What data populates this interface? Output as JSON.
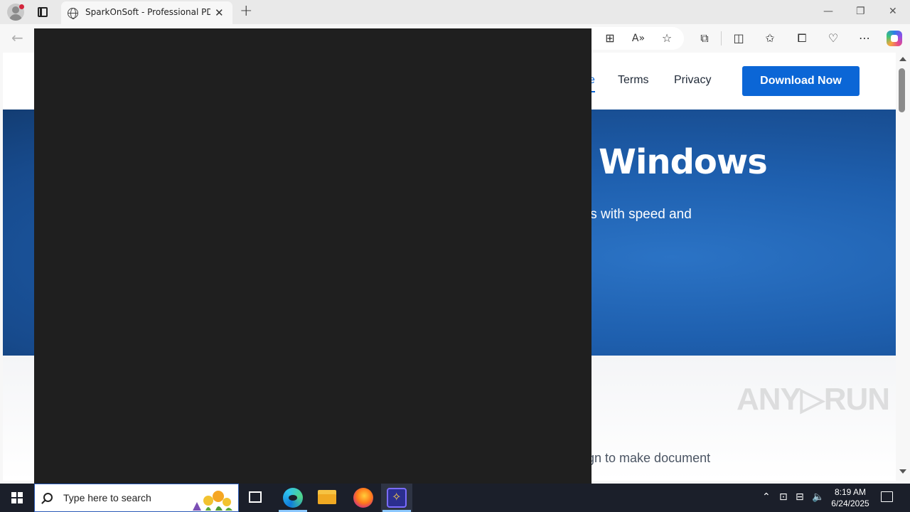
{
  "browser": {
    "tab_title": "SparkOnSoft - Professional PDF S",
    "tab_close": "✕",
    "new_tab": "+",
    "window_controls": {
      "minimize": "—",
      "restore": "❐",
      "close": "✕"
    },
    "toolbar_icons": [
      "back-arrow-icon",
      "app-available-icon",
      "read-aloud-icon",
      "favorite-star-icon",
      "extensions-icon",
      "split-screen-icon",
      "favorites-icon",
      "collections-icon",
      "browser-essentials-icon",
      "more-icon",
      "copilot-icon"
    ]
  },
  "site": {
    "nav": {
      "active_fragment": "e",
      "terms": "Terms",
      "privacy": "Privacy",
      "download": "Download Now"
    },
    "hero": {
      "title_fragment": "Windows",
      "subtitle_fragment": "ls with speed and"
    },
    "lower_text_fragment": "gn to make document"
  },
  "watermark": "ANY▷RUN",
  "taskbar": {
    "search_placeholder": "Type here to search",
    "time": "8:19 AM",
    "date": "6/24/2025"
  },
  "colors": {
    "accent_blue": "#0b66d6",
    "hero_blue": "#1e5fae",
    "overlay": "#1f1f1f",
    "taskbar": "#1b1f2a"
  }
}
